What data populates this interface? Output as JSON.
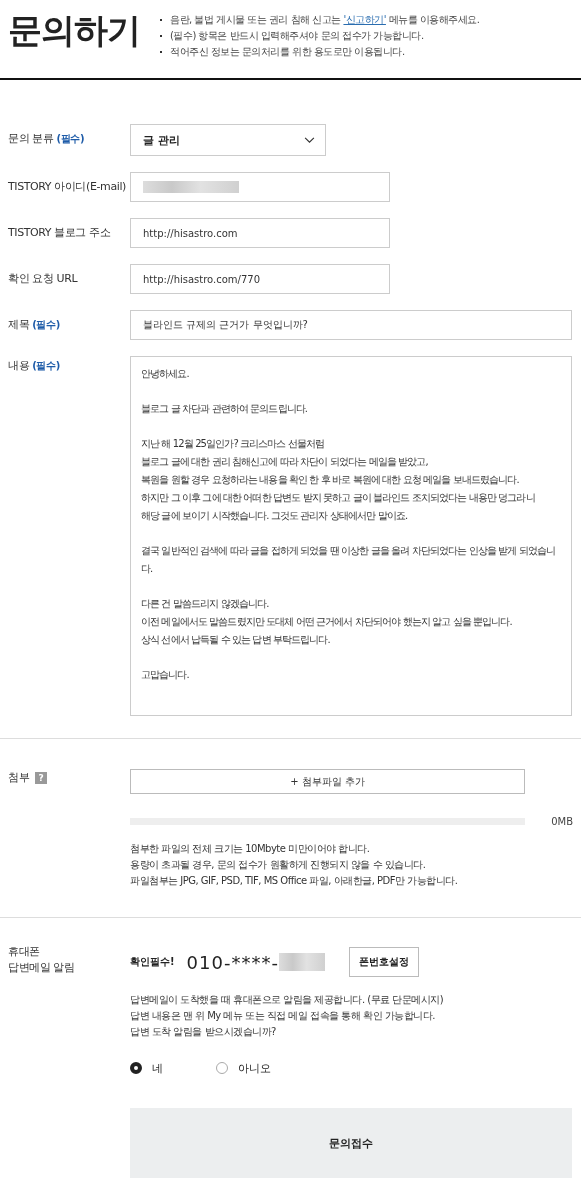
{
  "header": {
    "title": "문의하기",
    "notices": [
      {
        "text": "음란, 불법 게시물 또는 권리 침해 신고는 ",
        "link": "'신고하기'",
        "after": " 메뉴를 이용해주세요."
      },
      {
        "text": "(필수) 항목은 반드시 입력해주셔야 문의 접수가 가능합니다."
      },
      {
        "text": "적어주신 정보는 문의처리를 위한 용도로만 이용됩니다."
      }
    ]
  },
  "form": {
    "fields": [
      {
        "kind": "select",
        "label": "문의 분류",
        "required": "(필수)",
        "value": "글 관리"
      },
      {
        "kind": "blurred",
        "label": "TISTORY 아이디(E-mail)"
      },
      {
        "kind": "text",
        "label": "TISTORY 블로그 주소",
        "value": "http://hisastro.com"
      },
      {
        "kind": "text",
        "label": "확인 요청 URL",
        "value": "http://hisastro.com/770"
      },
      {
        "kind": "wide",
        "label": "제목",
        "required": "(필수)",
        "value": "블라인드 규제의 근거가 무엇입니까?"
      },
      {
        "kind": "textarea",
        "label": "내용",
        "required": "(필수)",
        "paragraphs": [
          [
            "안녕하세요."
          ],
          [
            "블로그 글 차단과 관련하여 문의드립니다."
          ],
          [
            "지난 해 12월 25일인가? 크리스마스 선물처럼",
            "블로그 글에 대한 권리 침해신고에 따라 차단이 되었다는 메일을 받았고,",
            "복원을 원할 경우 요청하라는 내용을 확인 한 후 바로 복원에 대한 요청 메일을 보내드렸습니다.",
            "하지만 그 이후 그에 대한 어떠한 답변도 받지 못하고 글이 블라인드 조치되었다는 내용만 덩그라니",
            "해당 글에 보이기 시작했습니다. 그것도 관리자 상태에서만 말이죠."
          ],
          [
            "결국 일반적인 검색에 따라 글을 접하게 되었을 땐 이상한 글을 올려 차단되었다는 인상을 받게 되었습니다."
          ],
          [
            "다른 건 말씀드리지 않겠습니다.",
            "이전 메일에서도 말씀드렸지만 도대체 어떤 근거에서 차단되어야 했는지 알고 싶을 뿐입니다.",
            "상식 선에서 납득될 수 있는 답변 부탁드립니다."
          ],
          [
            "고맙습니다."
          ]
        ]
      }
    ]
  },
  "attachment": {
    "label": "첨부",
    "help": "?",
    "button": "+ 첨부파일 추가",
    "level": 0,
    "size": "0MB",
    "notes": [
      "첨부한 파일의 전체 크기는 10Mbyte 미만이어야 합니다.",
      "용량이 초과될 경우, 문의 접수가 원활하게 진행되지 않을 수 있습니다.",
      "파일첨부는 JPG, GIF, PSD, TIF, MS Office 파일, 아래한글, PDF만 가능합니다."
    ]
  },
  "phone": {
    "label_lines": [
      "휴대폰",
      "답변메일 알림"
    ],
    "check": "확인필수!",
    "number": "010-****-",
    "button": "폰번호설정",
    "notes": [
      "답변메일이 도착했을 때 휴대폰으로 알림을 제공합니다. (무료 단문메시지)",
      "답변 내용은 맨 위 My 메뉴 또는 직접 메일 접속을 통해 확인 가능합니다.",
      "답변 도착 알림을 받으시겠습니까?"
    ],
    "options": [
      {
        "label": "네",
        "selected": true
      },
      {
        "label": "아니오",
        "selected": false
      }
    ]
  },
  "submit": "문의접수"
}
